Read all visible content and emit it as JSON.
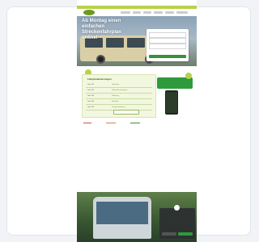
{
  "page": {
    "header": {
      "nav": [
        "",
        "",
        "",
        "",
        "",
        ""
      ]
    },
    "hero": {
      "headline_lines": [
        "Ab Montag einen",
        "einfachen",
        "Streckenfahrplan",
        "online!"
      ]
    },
    "panel": {
      "title": "Fahrplanänderungen",
      "rows": [
        {
          "line": "Linie 101",
          "detail": "Umleitung"
        },
        {
          "line": "Linie 102",
          "detail": "Haltestellenverlegung"
        },
        {
          "line": "Linie 103",
          "detail": "Umleitung"
        },
        {
          "line": "Linie 104",
          "detail": "Baustelle"
        },
        {
          "line": "Linie 105",
          "detail": "Fahrplanänderung"
        }
      ]
    },
    "colors": {
      "lime": "#b8d24a",
      "green": "#2e9a3c",
      "dark_green": "#385f18"
    },
    "icons": {
      "logo": "logo-icon",
      "bus": "bus-photo",
      "phone": "phone-mockup",
      "cookie": "cookie-icon"
    }
  }
}
